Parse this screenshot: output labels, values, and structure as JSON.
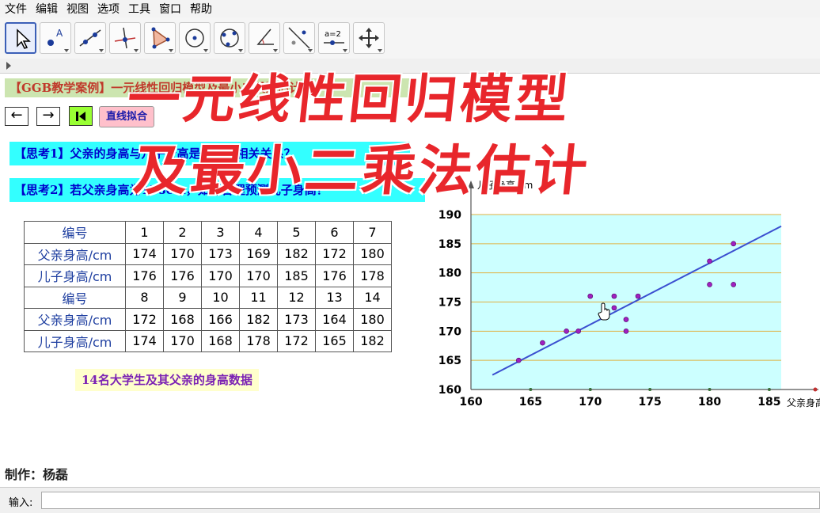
{
  "menu": [
    "文件",
    "编辑",
    "视图",
    "选项",
    "工具",
    "窗口",
    "帮助"
  ],
  "tools": [
    {
      "icon": "move-arrow-icon",
      "active": true
    },
    {
      "icon": "point-icon"
    },
    {
      "icon": "line-icon"
    },
    {
      "icon": "perpendicular-line-icon"
    },
    {
      "icon": "polygon-icon"
    },
    {
      "icon": "circle-icon"
    },
    {
      "icon": "ellipse-icon"
    },
    {
      "icon": "angle-icon"
    },
    {
      "icon": "reflect-icon"
    },
    {
      "icon": "slider-icon",
      "text": "a=2"
    },
    {
      "icon": "move-view-icon"
    }
  ],
  "case_title": "【GGB教学案例】一元线性回归模型及最小二乘法估计",
  "buttons": {
    "prev": "←",
    "next": "→",
    "fit": "直线拟合"
  },
  "questions": {
    "q1": "【思考1】父亲的身高与儿子身高是否具有相关关系？",
    "q2": "【思考2】若父亲身高为178cm，如何合理预测儿子身高？"
  },
  "table": {
    "rows": [
      [
        "编号",
        "1",
        "2",
        "3",
        "4",
        "5",
        "6",
        "7"
      ],
      [
        "父亲身高/cm",
        "174",
        "170",
        "173",
        "169",
        "182",
        "172",
        "180"
      ],
      [
        "儿子身高/cm",
        "176",
        "176",
        "170",
        "170",
        "185",
        "176",
        "178"
      ],
      [
        "编号",
        "8",
        "9",
        "10",
        "11",
        "12",
        "13",
        "14"
      ],
      [
        "父亲身高/cm",
        "172",
        "168",
        "166",
        "182",
        "173",
        "164",
        "180"
      ],
      [
        "儿子身高/cm",
        "174",
        "170",
        "168",
        "178",
        "172",
        "165",
        "182"
      ]
    ]
  },
  "caption": "14名大学生及其父亲的身高数据",
  "author": "制作：杨磊",
  "input_label": "输入:",
  "overlay": {
    "line1": "一元线性回归模型",
    "line2": "及最小二乘法估计"
  },
  "colors": {
    "plot_bg": "#ccffff",
    "gridline": "#e0b040",
    "point": "#a020c0",
    "fit_line": "#3b4fd0",
    "overlay": "#e8262b"
  },
  "chart_data": {
    "type": "scatter",
    "xlabel": "父亲身高/cm",
    "ylabel": "儿子身高/cm",
    "xlim": [
      160,
      186
    ],
    "ylim": [
      160,
      190
    ],
    "xticks": [
      160,
      165,
      170,
      175,
      180,
      185
    ],
    "yticks": [
      160,
      165,
      170,
      175,
      180,
      185,
      190
    ],
    "points": [
      [
        174,
        176
      ],
      [
        170,
        176
      ],
      [
        173,
        170
      ],
      [
        169,
        170
      ],
      [
        182,
        185
      ],
      [
        172,
        176
      ],
      [
        180,
        178
      ],
      [
        172,
        174
      ],
      [
        168,
        170
      ],
      [
        166,
        168
      ],
      [
        182,
        178
      ],
      [
        173,
        172
      ],
      [
        164,
        165
      ],
      [
        180,
        182
      ]
    ],
    "fit_line": {
      "x": [
        161.8,
        186
      ],
      "y": [
        162.5,
        188
      ]
    },
    "grid": "horizontal"
  }
}
